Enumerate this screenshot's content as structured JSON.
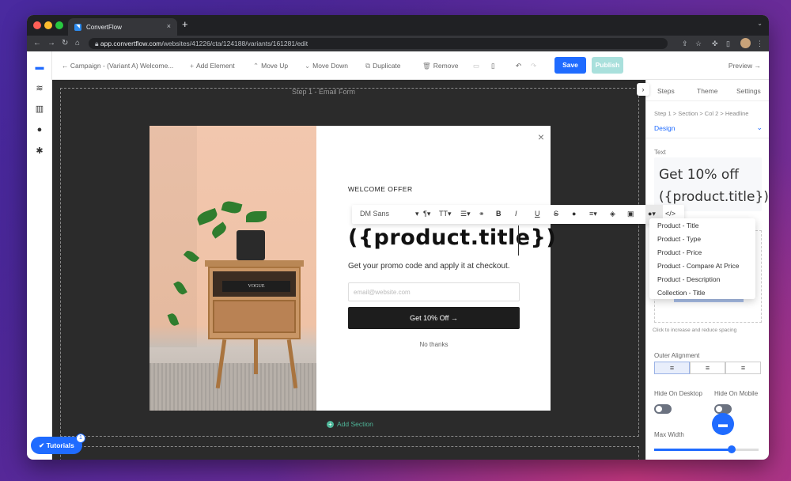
{
  "browser": {
    "tab_title": "ConvertFlow",
    "tab_close": "×",
    "new_tab": "+",
    "url_host": "app.convertflow.com",
    "url_path": "/websites/41226/cta/124188/variants/161281/edit"
  },
  "toolbar": {
    "back_label": "← Campaign - (Variant A) Welcome...",
    "add_element": "Add Element",
    "move_up": "Move Up",
    "move_down": "Move Down",
    "duplicate": "Duplicate",
    "remove": "Remove",
    "save": "Save",
    "publish": "Publish",
    "preview": "Preview →"
  },
  "canvas": {
    "step_label": "Step 1 - Email Form",
    "add_section": "Add Section"
  },
  "popup": {
    "close": "×",
    "photo_book_text": "VOGUE",
    "eyebrow": "WELCOME OFFER",
    "headline": "({product.title})",
    "subtext": "Get your promo code and apply it at checkout.",
    "email_placeholder": "email@website.com",
    "cta": "Get 10% Off →",
    "no_thanks": "No thanks"
  },
  "format_toolbar": {
    "font": "DM Sans",
    "bold": "B",
    "italic": "I",
    "underline": "U",
    "strike": "S",
    "code": "</>"
  },
  "merge_dropdown": {
    "items": [
      "Product - Title",
      "Product - Type",
      "Product - Price",
      "Product - Compare At Price",
      "Product - Description",
      "Collection - Title"
    ]
  },
  "panel": {
    "tabs": [
      "Steps",
      "Theme",
      "Settings"
    ],
    "breadcrumb": "Step 1 > Section > Col 2 > Headline",
    "design": "Design",
    "text_label": "Text",
    "text_line1": "Get 10% off",
    "text_line2": "({product.title})",
    "spacing_hint": "Click to increase and reduce spacing",
    "outer_alignment": "Outer Alignment",
    "hide_desktop": "Hide On Desktop",
    "hide_mobile": "Hide On Mobile",
    "max_width": "Max Width",
    "max_width_level": 0.76
  },
  "tutorials": {
    "label": "Tutorials",
    "badge": "1"
  },
  "colors": {
    "accent": "#1f6bff",
    "publish": "#a9e0dc",
    "add_section": "#4fb79a",
    "canvas": "#2b2b2b"
  }
}
